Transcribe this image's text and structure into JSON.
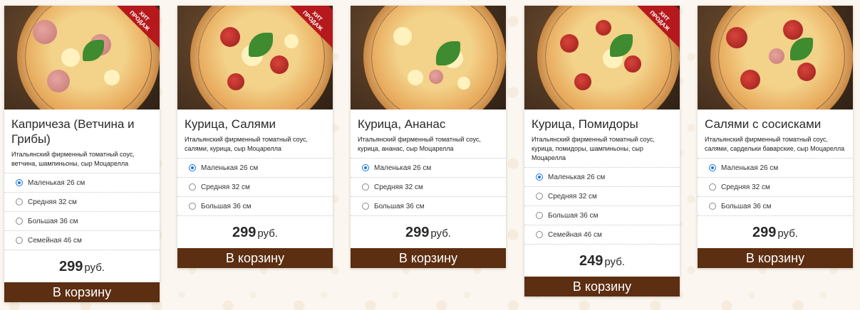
{
  "badge": [
    "ХИТ",
    "ПРОДАЖ"
  ],
  "currency": "руб.",
  "cart_label": "В корзину",
  "products": [
    {
      "title": "Капричеза (Ветчина и Грибы)",
      "description": "Итальянский фирменный томатный соус, ветчина, шампиньоны, сыр Моцарелла",
      "sizes": [
        "Маленькая 26 см",
        "Средняя 32 см",
        "Большая 36 см",
        "Семейная 46 см"
      ],
      "selected": "Маленькая 26 см",
      "price": "299",
      "hit": true
    },
    {
      "title": "Курица, Салями",
      "description": "Итальянский фирменный томатный соус, салями, курица, сыр Моцарелла",
      "sizes": [
        "Маленькая 26 см",
        "Средняя 32 см",
        "Большая 36 см"
      ],
      "selected": "Маленькая 26 см",
      "price": "299",
      "hit": true
    },
    {
      "title": "Курица, Ананас",
      "description": "Итальянский фирменный томатный соус, курица, ананас, сыр Моцарелла",
      "sizes": [
        "Маленькая 26 см",
        "Средняя 32 см",
        "Большая 36 см"
      ],
      "selected": "Маленькая 26 см",
      "price": "299",
      "hit": false
    },
    {
      "title": "Курица, Помидоры",
      "description": "Итальянский фирменный томатный соус, курица, помидоры, шампиньоны, сыр Моцарелла",
      "sizes": [
        "Маленькая 26 см",
        "Средняя 32 см",
        "Большая 36 см",
        "Семейная 46 см"
      ],
      "selected": "Маленькая 26 см",
      "price": "249",
      "hit": true
    },
    {
      "title": "Салями с сосисками",
      "description": "Итальянский фирменный томатный соус, салями, сардельки баварские, сыр Моцарелла",
      "sizes": [
        "Маленькая 26 см",
        "Средняя 32 см",
        "Большая 36 см"
      ],
      "selected": "Маленькая 26 см",
      "price": "299",
      "hit": false
    }
  ]
}
